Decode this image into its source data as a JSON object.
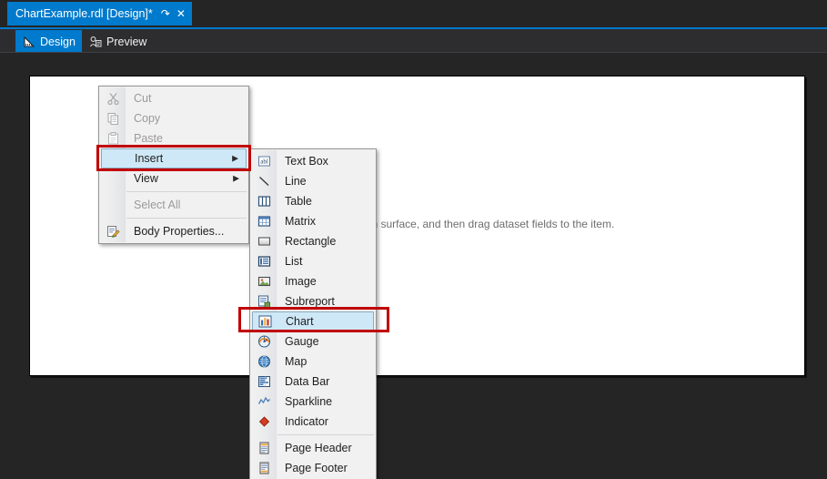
{
  "window": {
    "document_tab": {
      "title": "ChartExample.rdl [Design]*",
      "pin_icon": "pin-icon",
      "close_icon": "close-icon"
    },
    "view_tabs": [
      {
        "label": "Design",
        "icon": "design-ruler-icon",
        "active": true
      },
      {
        "label": "Preview",
        "icon": "preview-person-icon",
        "active": false
      }
    ]
  },
  "design_surface": {
    "hint_text": "Drag an item from the toolbox to the design surface, and then drag dataset fields to the item."
  },
  "context_menu": {
    "items": [
      {
        "label": "Cut",
        "icon": "cut-scissors-icon",
        "disabled": true,
        "submenu": false,
        "highlighted": false
      },
      {
        "label": "Copy",
        "icon": "copy-pages-icon",
        "disabled": true,
        "submenu": false,
        "highlighted": false
      },
      {
        "label": "Paste",
        "icon": "paste-clipboard-icon",
        "disabled": true,
        "submenu": false,
        "highlighted": false
      },
      {
        "label": "Insert",
        "icon": "none",
        "disabled": false,
        "submenu": true,
        "highlighted": true
      },
      {
        "label": "View",
        "icon": "none",
        "disabled": false,
        "submenu": true,
        "highlighted": false
      },
      {
        "label": "Select All",
        "icon": "none",
        "disabled": true,
        "submenu": false,
        "highlighted": false
      },
      {
        "label": "Body Properties...",
        "icon": "body-properties-icon",
        "disabled": false,
        "submenu": false,
        "highlighted": false
      }
    ]
  },
  "insert_submenu": {
    "items": [
      {
        "label": "Text Box",
        "icon": "textbox-icon",
        "highlighted": false
      },
      {
        "label": "Line",
        "icon": "line-icon",
        "highlighted": false
      },
      {
        "label": "Table",
        "icon": "table-icon",
        "highlighted": false
      },
      {
        "label": "Matrix",
        "icon": "matrix-icon",
        "highlighted": false
      },
      {
        "label": "Rectangle",
        "icon": "rectangle-icon",
        "highlighted": false
      },
      {
        "label": "List",
        "icon": "list-icon",
        "highlighted": false
      },
      {
        "label": "Image",
        "icon": "image-icon",
        "highlighted": false
      },
      {
        "label": "Subreport",
        "icon": "subreport-icon",
        "highlighted": false
      },
      {
        "label": "Chart",
        "icon": "chart-bar-icon",
        "highlighted": true
      },
      {
        "label": "Gauge",
        "icon": "gauge-icon",
        "highlighted": false
      },
      {
        "label": "Map",
        "icon": "map-globe-icon",
        "highlighted": false
      },
      {
        "label": "Data Bar",
        "icon": "data-bar-icon",
        "highlighted": false
      },
      {
        "label": "Sparkline",
        "icon": "sparkline-icon",
        "highlighted": false
      },
      {
        "label": "Indicator",
        "icon": "indicator-diamond-icon",
        "highlighted": false
      },
      {
        "label": "Page Header",
        "icon": "page-header-icon",
        "highlighted": false
      },
      {
        "label": "Page Footer",
        "icon": "page-footer-icon",
        "highlighted": false
      }
    ]
  },
  "annotations": [
    {
      "name": "insert-highlight-box",
      "target": "Insert"
    },
    {
      "name": "chart-highlight-box",
      "target": "Chart"
    }
  ],
  "colors": {
    "accent_blue": "#007acc",
    "annotation_red": "#c00000",
    "menu_highlight": "#cfe8f7",
    "shell_background": "#252526",
    "design_page": "#ffffff"
  }
}
